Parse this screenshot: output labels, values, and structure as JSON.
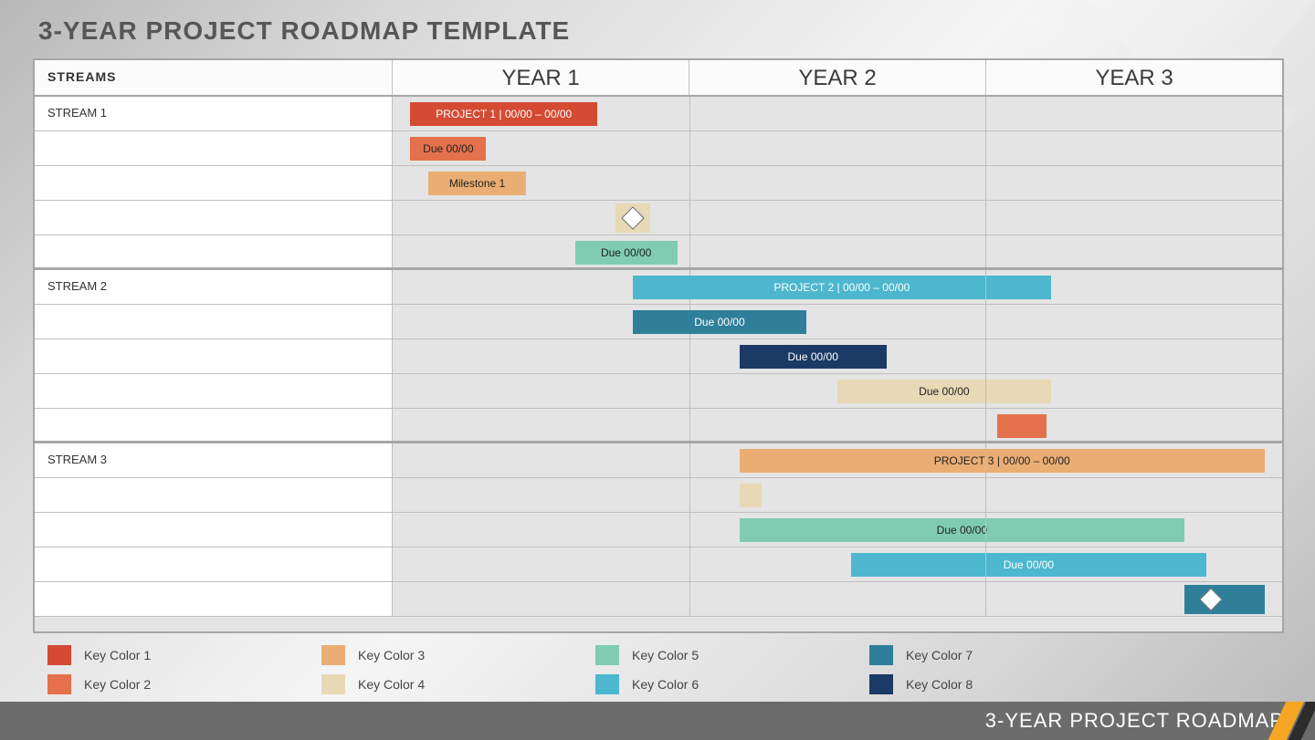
{
  "title": "3-YEAR PROJECT ROADMAP TEMPLATE",
  "footer": "3-YEAR PROJECT ROADMAP",
  "columns_header": "STREAMS",
  "years": [
    "YEAR 1",
    "YEAR 2",
    "YEAR 3"
  ],
  "colors": {
    "key1": "#d44a33",
    "key2": "#e4714b",
    "key3": "#eaae74",
    "key4": "#e7d9b6",
    "key5": "#7fccb3",
    "key6": "#4cb7ce",
    "key7": "#2f7f9b",
    "key8": "#1b3a66"
  },
  "legend": [
    {
      "label": "Key Color 1",
      "color": "key1"
    },
    {
      "label": "Key Color 2",
      "color": "key2"
    },
    {
      "label": "Key Color 3",
      "color": "key3"
    },
    {
      "label": "Key Color 4",
      "color": "key4"
    },
    {
      "label": "Key Color 5",
      "color": "key5"
    },
    {
      "label": "Key Color 6",
      "color": "key6"
    },
    {
      "label": "Key Color 7",
      "color": "key7"
    },
    {
      "label": "Key Color 8",
      "color": "key8"
    }
  ],
  "streams": [
    {
      "name": "STREAM 1",
      "rows": [
        {
          "label": "STREAM 1",
          "bar": {
            "text": "PROJECT 1   |   00/00 – 00/00",
            "color": "key1",
            "fg": "#fff",
            "start_pct": 2,
            "width_pct": 21,
            "kind": "project"
          }
        },
        {
          "label": "",
          "bar": {
            "text": "Due 00/00",
            "color": "key2",
            "fg": "#222",
            "start_pct": 2,
            "width_pct": 8.5,
            "kind": "thin"
          }
        },
        {
          "label": "",
          "bar": {
            "text": "Milestone 1",
            "color": "key3",
            "fg": "#222",
            "start_pct": 4,
            "width_pct": 11,
            "kind": "thin"
          }
        },
        {
          "label": "",
          "bar": {
            "text": "",
            "color": "key4",
            "fg": "#222",
            "start_pct": 25,
            "width_pct": 4,
            "kind": "diamond",
            "diamond_at": 27
          }
        },
        {
          "label": "",
          "bar": {
            "text": "Due 00/00",
            "color": "key5",
            "fg": "#222",
            "start_pct": 20.5,
            "width_pct": 11.5,
            "kind": "thin"
          }
        }
      ]
    },
    {
      "name": "STREAM 2",
      "rows": [
        {
          "label": "STREAM 2",
          "bar": {
            "text": "PROJECT 2   |   00/00 – 00/00",
            "color": "key6",
            "fg": "#fff",
            "start_pct": 27,
            "width_pct": 47,
            "kind": "project"
          }
        },
        {
          "label": "",
          "bar": {
            "text": "Due 00/00",
            "color": "key7",
            "fg": "#fff",
            "start_pct": 27,
            "width_pct": 19.5,
            "kind": "thin"
          }
        },
        {
          "label": "",
          "bar": {
            "text": "Due 00/00",
            "color": "key8",
            "fg": "#fff",
            "start_pct": 39,
            "width_pct": 16.5,
            "kind": "thin"
          }
        },
        {
          "label": "",
          "bar": {
            "text": "Due 00/00",
            "color": "key4",
            "fg": "#222",
            "start_pct": 50,
            "width_pct": 24,
            "kind": "thin"
          }
        },
        {
          "label": "",
          "bar": {
            "text": "",
            "color": "key2",
            "fg": "#fff",
            "start_pct": 68,
            "width_pct": 5.5,
            "kind": "thin"
          }
        }
      ]
    },
    {
      "name": "STREAM 3",
      "rows": [
        {
          "label": "STREAM 3",
          "bar": {
            "text": "PROJECT 3   |   00/00 – 00/00",
            "color": "key3",
            "fg": "#222",
            "start_pct": 39,
            "width_pct": 59,
            "kind": "project"
          }
        },
        {
          "label": "",
          "bar": {
            "text": "",
            "color": "key4",
            "fg": "#222",
            "start_pct": 39,
            "width_pct": 2.5,
            "kind": "thin"
          }
        },
        {
          "label": "",
          "bar": {
            "text": "Due 00/00",
            "color": "key5",
            "fg": "#222",
            "start_pct": 39,
            "width_pct": 50,
            "kind": "thin"
          }
        },
        {
          "label": "",
          "bar": {
            "text": "Due 00/00",
            "color": "key6",
            "fg": "#fff",
            "start_pct": 51.5,
            "width_pct": 40,
            "kind": "thin"
          }
        },
        {
          "label": "",
          "bar": {
            "text": "",
            "color": "key7",
            "fg": "#fff",
            "start_pct": 89,
            "width_pct": 9,
            "kind": "diamond",
            "diamond_at": 92
          }
        }
      ]
    }
  ],
  "chart_data": {
    "type": "gantt",
    "x_axis": {
      "unit": "year",
      "categories": [
        "YEAR 1",
        "YEAR 2",
        "YEAR 3"
      ],
      "range_months": [
        0,
        36
      ]
    },
    "streams": [
      {
        "name": "STREAM 1",
        "items": [
          {
            "type": "project",
            "label": "PROJECT 1",
            "date_label": "00/00 – 00/00",
            "start_month": 0.7,
            "end_month": 8.3,
            "color": "Key Color 1"
          },
          {
            "type": "due",
            "label": "Due 00/00",
            "start_month": 0.7,
            "end_month": 3.8,
            "color": "Key Color 2"
          },
          {
            "type": "milestone-bar",
            "label": "Milestone 1",
            "start_month": 1.4,
            "end_month": 5.4,
            "color": "Key Color 3"
          },
          {
            "type": "milestone-marker",
            "label": "",
            "at_month": 9.7,
            "color": "Key Color 4"
          },
          {
            "type": "due",
            "label": "Due 00/00",
            "start_month": 7.4,
            "end_month": 11.5,
            "color": "Key Color 5"
          }
        ]
      },
      {
        "name": "STREAM 2",
        "items": [
          {
            "type": "project",
            "label": "PROJECT 2",
            "date_label": "00/00 – 00/00",
            "start_month": 9.7,
            "end_month": 26.6,
            "color": "Key Color 6"
          },
          {
            "type": "due",
            "label": "Due 00/00",
            "start_month": 9.7,
            "end_month": 16.7,
            "color": "Key Color 7"
          },
          {
            "type": "due",
            "label": "Due 00/00",
            "start_month": 14.0,
            "end_month": 20.0,
            "color": "Key Color 8"
          },
          {
            "type": "due",
            "label": "Due 00/00",
            "start_month": 18.0,
            "end_month": 26.6,
            "color": "Key Color 4"
          },
          {
            "type": "bar",
            "label": "",
            "start_month": 24.5,
            "end_month": 26.5,
            "color": "Key Color 2"
          }
        ]
      },
      {
        "name": "STREAM 3",
        "items": [
          {
            "type": "project",
            "label": "PROJECT 3",
            "date_label": "00/00 – 00/00",
            "start_month": 14.0,
            "end_month": 35.3,
            "color": "Key Color 3"
          },
          {
            "type": "bar",
            "label": "",
            "start_month": 14.0,
            "end_month": 14.9,
            "color": "Key Color 4"
          },
          {
            "type": "due",
            "label": "Due 00/00",
            "start_month": 14.0,
            "end_month": 32.0,
            "color": "Key Color 5"
          },
          {
            "type": "due",
            "label": "Due 00/00",
            "start_month": 18.5,
            "end_month": 33.0,
            "color": "Key Color 6"
          },
          {
            "type": "milestone-marker",
            "label": "",
            "at_month": 33.1,
            "bar_start_month": 32.0,
            "bar_end_month": 35.3,
            "color": "Key Color 7"
          }
        ]
      }
    ]
  }
}
